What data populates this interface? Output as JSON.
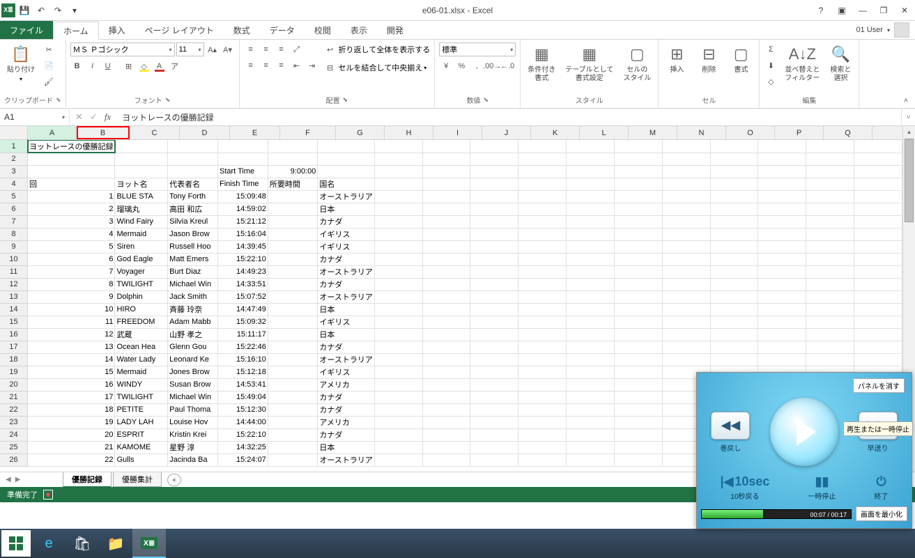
{
  "app": {
    "title": "e06-01.xlsx - Excel",
    "user": "01 User"
  },
  "qat": {
    "save": "💾",
    "undo": "↶",
    "redo": "↷"
  },
  "tabs": [
    "ファイル",
    "ホーム",
    "挿入",
    "ページ レイアウト",
    "数式",
    "データ",
    "校閲",
    "表示",
    "開発"
  ],
  "ribbon": {
    "clipboard": {
      "label": "クリップボード",
      "paste": "貼り付け"
    },
    "font": {
      "label": "フォント",
      "name": "ＭＳ Ｐゴシック",
      "size": "11",
      "bold": "B",
      "italic": "I",
      "underline": "U"
    },
    "alignment": {
      "label": "配置",
      "wrap": "折り返して全体を表示する",
      "merge": "セルを結合して中央揃え"
    },
    "number": {
      "label": "数値",
      "format": "標準"
    },
    "styles": {
      "label": "スタイル",
      "cond": "条件付き\n書式",
      "table": "テーブルとして\n書式設定",
      "cell": "セルの\nスタイル"
    },
    "cells": {
      "label": "セル",
      "insert": "挿入",
      "delete": "削除",
      "format": "書式"
    },
    "editing": {
      "label": "編集",
      "sort": "並べ替えと\nフィルター",
      "find": "検索と\n選択"
    }
  },
  "formula_bar": {
    "name_box": "A1",
    "formula": "ヨットレースの優勝記録"
  },
  "columns": [
    "A",
    "B",
    "C",
    "D",
    "E",
    "F",
    "G",
    "H",
    "I",
    "J",
    "K",
    "L",
    "M",
    "N",
    "O",
    "P",
    "Q"
  ],
  "headers": {
    "r3": {
      "D": "Start Time",
      "E": "9:00:00"
    },
    "r4": {
      "A": "回",
      "B": "ヨット名",
      "C": "代表者名",
      "D": "Finish Time",
      "E": "所要時間",
      "F": "国名"
    }
  },
  "title_cell": "ヨットレースの優勝記録",
  "chart_data": {
    "type": "table",
    "columns": [
      "回",
      "ヨット名",
      "代表者名",
      "Finish Time",
      "所要時間",
      "国名"
    ],
    "start_time": "9:00:00",
    "rows": [
      {
        "no": 1,
        "yacht": "BLUE STA",
        "rep": "Tony Forth",
        "finish": "15:09:48",
        "elapsed": "",
        "country": "オーストラリア"
      },
      {
        "no": 2,
        "yacht": "瑠璃丸",
        "rep": "高田 和広",
        "finish": "14:59:02",
        "elapsed": "",
        "country": "日本"
      },
      {
        "no": 3,
        "yacht": "Wind Fairy",
        "rep": "Silvia Kreul",
        "finish": "15:21:12",
        "elapsed": "",
        "country": "カナダ"
      },
      {
        "no": 4,
        "yacht": "Mermaid",
        "rep": "Jason Brow",
        "finish": "15:16:04",
        "elapsed": "",
        "country": "イギリス"
      },
      {
        "no": 5,
        "yacht": "Siren",
        "rep": "Russell Hoo",
        "finish": "14:39:45",
        "elapsed": "",
        "country": "イギリス"
      },
      {
        "no": 6,
        "yacht": "God Eagle",
        "rep": "Matt Emers",
        "finish": "15:22:10",
        "elapsed": "",
        "country": "カナダ"
      },
      {
        "no": 7,
        "yacht": "Voyager",
        "rep": "Burt Diaz",
        "finish": "14:49:23",
        "elapsed": "",
        "country": "オーストラリア"
      },
      {
        "no": 8,
        "yacht": "TWILIGHT",
        "rep": "Michael Win",
        "finish": "14:33:51",
        "elapsed": "",
        "country": "カナダ"
      },
      {
        "no": 9,
        "yacht": "Dolphin",
        "rep": "Jack Smith",
        "finish": "15:07:52",
        "elapsed": "",
        "country": "オーストラリア"
      },
      {
        "no": 10,
        "yacht": "HIRO",
        "rep": "斉藤 玲奈",
        "finish": "14:47:49",
        "elapsed": "",
        "country": "日本"
      },
      {
        "no": 11,
        "yacht": "FREEDOM",
        "rep": "Adam Mabb",
        "finish": "15:09:32",
        "elapsed": "",
        "country": "イギリス"
      },
      {
        "no": 12,
        "yacht": "武蔵",
        "rep": "山野 孝之",
        "finish": "15:11:17",
        "elapsed": "",
        "country": "日本"
      },
      {
        "no": 13,
        "yacht": "Ocean Hea",
        "rep": "Glenn Gou",
        "finish": "15:22:46",
        "elapsed": "",
        "country": "カナダ"
      },
      {
        "no": 14,
        "yacht": "Water Lady",
        "rep": "Leonard Ke",
        "finish": "15:16:10",
        "elapsed": "",
        "country": "オーストラリア"
      },
      {
        "no": 15,
        "yacht": "Mermaid",
        "rep": "Jones Brow",
        "finish": "15:12:18",
        "elapsed": "",
        "country": "イギリス"
      },
      {
        "no": 16,
        "yacht": "WINDY",
        "rep": "Susan Brow",
        "finish": "14:53:41",
        "elapsed": "",
        "country": "アメリカ"
      },
      {
        "no": 17,
        "yacht": "TWILIGHT",
        "rep": "Michael Win",
        "finish": "15:49:04",
        "elapsed": "",
        "country": "カナダ"
      },
      {
        "no": 18,
        "yacht": "PETITE",
        "rep": "Paul Thoma",
        "finish": "15:12:30",
        "elapsed": "",
        "country": "カナダ"
      },
      {
        "no": 19,
        "yacht": "LADY LAH",
        "rep": "Louise Hov",
        "finish": "14:44:00",
        "elapsed": "",
        "country": "アメリカ"
      },
      {
        "no": 20,
        "yacht": "ESPRIT",
        "rep": "Kristin Krei",
        "finish": "15:22:10",
        "elapsed": "",
        "country": "カナダ"
      },
      {
        "no": 21,
        "yacht": "KAMOME",
        "rep": "星野 淳",
        "finish": "14:32:25",
        "elapsed": "",
        "country": "日本"
      },
      {
        "no": 22,
        "yacht": "Gulls",
        "rep": "Jacinda Ba",
        "finish": "15:24:07",
        "elapsed": "",
        "country": "オーストラリア"
      }
    ]
  },
  "sheets": {
    "active": "優勝記録",
    "tabs": [
      "優勝記録",
      "優勝集計"
    ]
  },
  "status": {
    "ready": "準備完了"
  },
  "media": {
    "hide_panel": "パネルを消す",
    "rewind": "巻戻し",
    "fast_forward": "早送り",
    "tooltip": "再生または一時停止",
    "back10": "10秒戻る",
    "back10_btn": "10sec",
    "pause": "一時停止",
    "end": "終了",
    "time": "00:07 / 00:17",
    "minimize": "画面を最小化"
  }
}
